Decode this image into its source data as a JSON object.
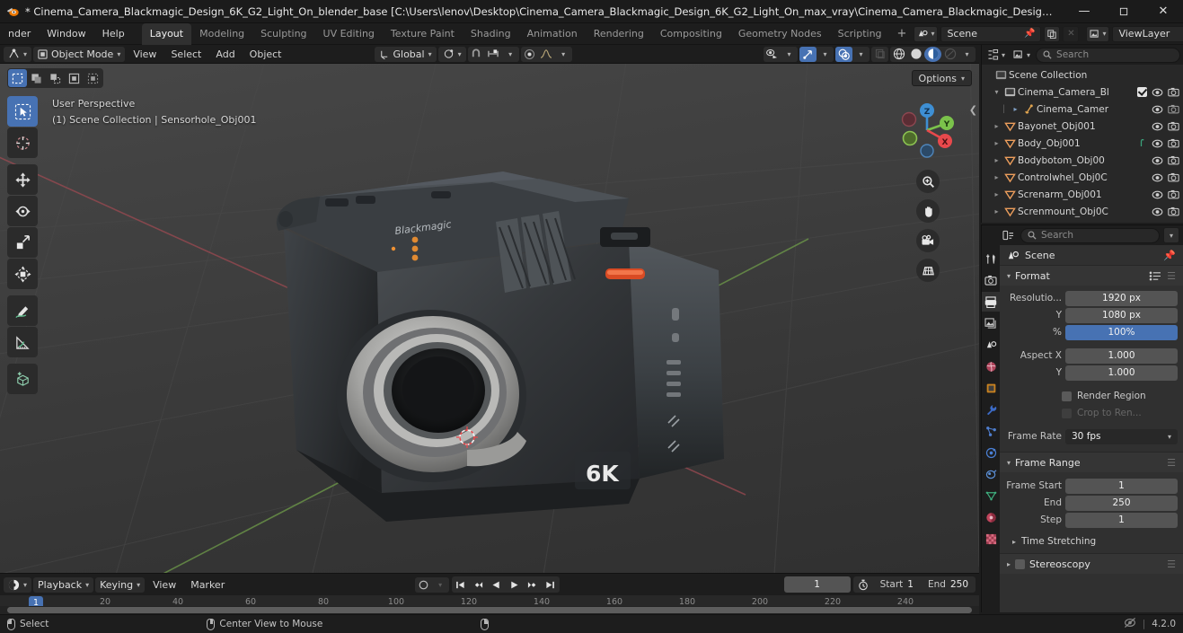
{
  "titlebar": {
    "title": "* Cinema_Camera_Blackmagic_Design_6K_G2_Light_On_blender_base [C:\\Users\\lenov\\Desktop\\Cinema_Camera_Blackmagic_Design_6K_G2_Light_On_max_vray\\Cinema_Camera_Blackmagic_Design_6K_G2_Light_On_blender_...",
    "minimize": "—",
    "maximize": "❐",
    "close": "✕",
    "app_icon": "blender-logo-icon"
  },
  "topbar": {
    "menus": [
      "nder",
      "Window",
      "Help"
    ],
    "workspaces": [
      {
        "label": "Layout",
        "active": true
      },
      {
        "label": "Modeling",
        "active": false
      },
      {
        "label": "Sculpting",
        "active": false
      },
      {
        "label": "UV Editing",
        "active": false
      },
      {
        "label": "Texture Paint",
        "active": false
      },
      {
        "label": "Shading",
        "active": false
      },
      {
        "label": "Animation",
        "active": false
      },
      {
        "label": "Rendering",
        "active": false
      },
      {
        "label": "Compositing",
        "active": false
      },
      {
        "label": "Geometry Nodes",
        "active": false
      },
      {
        "label": "Scripting",
        "active": false
      }
    ],
    "add_workspace": "+",
    "scene_name": "Scene",
    "viewlayer_name": "ViewLayer"
  },
  "viewport_header": {
    "editor_type": "editor-type-icon",
    "mode": "Object Mode",
    "menus": [
      "View",
      "Select",
      "Add",
      "Object"
    ],
    "transform_orientation": "Global",
    "snap": "snap-magnet-icon",
    "proportional": "proportional-edit-icon",
    "options": "Options",
    "shading_modes": [
      "wireframe",
      "solid",
      "material-preview",
      "rendered"
    ],
    "active_shading": "material-preview"
  },
  "viewport": {
    "perspective": "User Perspective",
    "scene_info": "(1) Scene Collection | Sensorhole_Obj001",
    "gizmo_axes": [
      "Z",
      "Y",
      "X"
    ],
    "nav_buttons": [
      "zoom-icon",
      "pan-hand-icon",
      "camera-view-icon",
      "toggle-ortho-icon"
    ],
    "tools": [
      "tweak-select-tool",
      "cursor-tool",
      "move-tool",
      "rotate-tool",
      "scale-tool",
      "transform-tool",
      "annotate-tool",
      "measure-tool",
      "add-cube-tool"
    ],
    "select_modes": [
      "select-box",
      "select-circle",
      "select-lasso",
      "select-extend",
      "select-tweak"
    ]
  },
  "outliner": {
    "display_mode": "view-layer-icon",
    "filter": "filter-icon",
    "search_placeholder": "Search",
    "root": "Scene Collection",
    "items": [
      {
        "name": "Cinema_Camera_Bl",
        "type": "collection",
        "indent": 1,
        "expanded": true,
        "checkbox": true
      },
      {
        "name": "Cinema_Camer",
        "type": "camera",
        "indent": 2,
        "expanded": false,
        "checkbox": false
      },
      {
        "name": "Bayonet_Obj001",
        "type": "mesh",
        "indent": 1,
        "expanded": false,
        "checkbox": false
      },
      {
        "name": "Body_Obj001",
        "type": "mesh",
        "indent": 1,
        "expanded": false,
        "checkbox": false,
        "extra": "modifier-icon"
      },
      {
        "name": "Bodybotom_Obj00",
        "type": "mesh",
        "indent": 1,
        "expanded": false,
        "checkbox": false
      },
      {
        "name": "Controlwhel_Obj0C",
        "type": "mesh",
        "indent": 1,
        "expanded": false,
        "checkbox": false
      },
      {
        "name": "Screnarm_Obj001",
        "type": "mesh",
        "indent": 1,
        "expanded": false,
        "checkbox": false
      },
      {
        "name": "Screnmount_Obj0C",
        "type": "mesh",
        "indent": 1,
        "expanded": false,
        "checkbox": false
      }
    ]
  },
  "properties": {
    "search_placeholder": "Search",
    "breadcrumb": "Scene",
    "tabs": [
      "tool-icon",
      "render-icon",
      "output-icon",
      "view-layer-icon",
      "scene-icon",
      "world-icon",
      "object-icon",
      "modifier-icon",
      "particles-icon",
      "physics-icon",
      "constraints-icon",
      "data-icon",
      "material-icon",
      "texture-icon"
    ],
    "active_tab_index": 2,
    "panels": {
      "format": {
        "title": "Format",
        "rows": [
          {
            "label": "Resolutio...",
            "value": "1920 px",
            "highlight": false
          },
          {
            "label": "Y",
            "value": "1080 px",
            "highlight": false
          },
          {
            "label": "%",
            "value": "100%",
            "highlight": true
          },
          {
            "label": "Aspect X",
            "value": "1.000",
            "highlight": false
          },
          {
            "label": "Y",
            "value": "1.000",
            "highlight": false
          }
        ],
        "checkboxes": [
          {
            "label": "Render Region",
            "checked": false,
            "disabled": false
          },
          {
            "label": "Crop to Ren...",
            "checked": false,
            "disabled": true
          }
        ],
        "frame_rate_label": "Frame Rate",
        "frame_rate_value": "30 fps"
      },
      "frame_range": {
        "title": "Frame Range",
        "rows": [
          {
            "label": "Frame Start",
            "value": "1"
          },
          {
            "label": "End",
            "value": "250"
          },
          {
            "label": "Step",
            "value": "1"
          }
        ],
        "time_stretching": "Time Stretching"
      },
      "stereoscopy": {
        "title": "Stereoscopy"
      }
    }
  },
  "timeline": {
    "editor_icon": "timeline-editor-icon",
    "menus": [
      "Playback",
      "Keying",
      "View",
      "Marker"
    ],
    "auto_key": "record-icon",
    "transport": [
      "jump-start",
      "prev-keyframe",
      "play-reverse",
      "play",
      "next-keyframe",
      "jump-end"
    ],
    "current_frame": "1",
    "use_preview_range_icon": "stopwatch-icon",
    "start_label": "Start",
    "start_value": "1",
    "end_label": "End",
    "end_value": "250",
    "ticks": [
      "20",
      "40",
      "60",
      "80",
      "100",
      "120",
      "140",
      "160",
      "180",
      "200",
      "220",
      "240"
    ],
    "playhead_frame": "1"
  },
  "statusbar": {
    "items": [
      {
        "mouse": "left",
        "label": "Select"
      },
      {
        "mouse": "middle",
        "label": "Center View to Mouse"
      },
      {
        "mouse": "right",
        "label": ""
      }
    ],
    "version": "4.2.0",
    "scene_stats_icon": "no-stats-icon"
  },
  "colors": {
    "accent_blue": "#4772b3",
    "header_bg": "#1d1d1d",
    "panel_bg": "#303030",
    "field_bg": "#545454",
    "viewport_bg": "#3b3b3b",
    "mesh_orange": "#ed9e5c",
    "axis_x_red": "#e8494c",
    "axis_y_green": "#7bc24b",
    "axis_z_blue": "#3e8fd4"
  }
}
